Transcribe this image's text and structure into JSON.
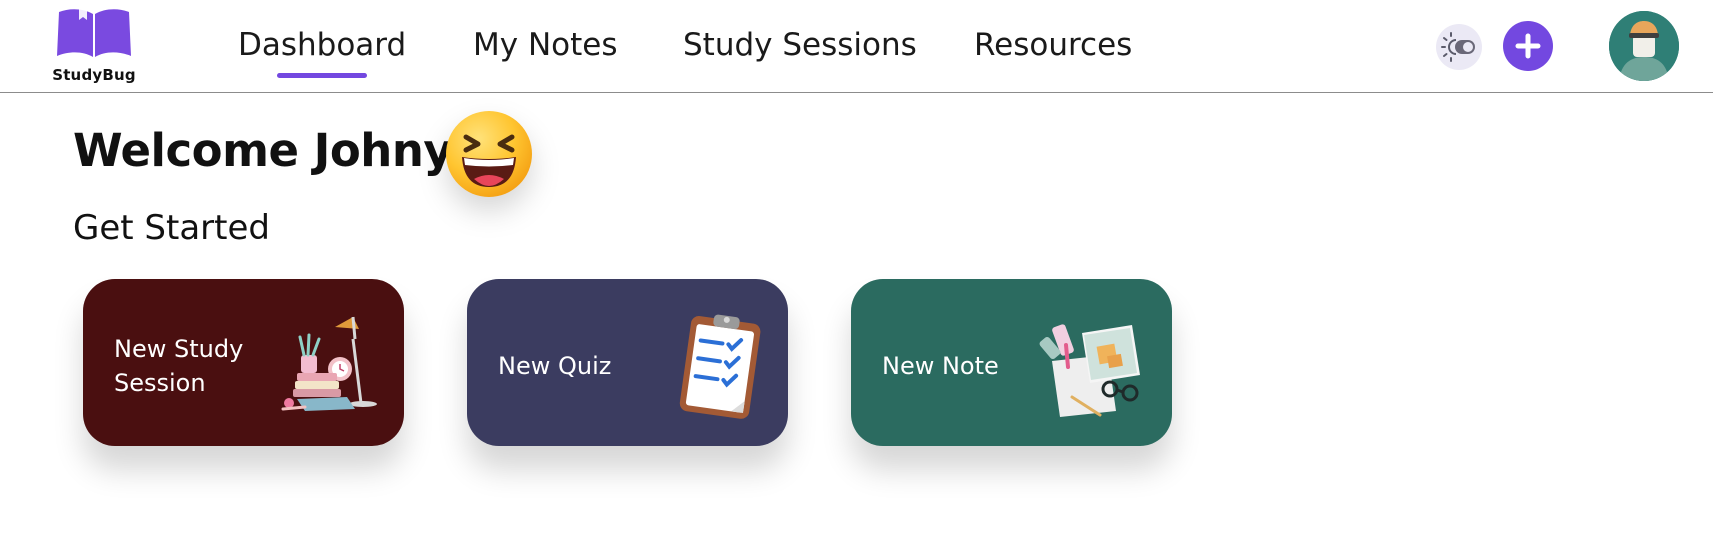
{
  "app": {
    "name": "StudyBug"
  },
  "nav": {
    "items": [
      {
        "label": "Dashboard",
        "active": true
      },
      {
        "label": "My Notes",
        "active": false
      },
      {
        "label": "Study Sessions",
        "active": false
      },
      {
        "label": "Resources",
        "active": false
      }
    ]
  },
  "header_actions": {
    "theme_toggle_icon": "brightness-toggle-icon",
    "add_icon": "plus-icon",
    "avatar_icon": "user-avatar"
  },
  "main": {
    "welcome": "Welcome Johny!",
    "emoji_icon": "laughing-face-emoji",
    "subtitle": "Get Started"
  },
  "cards": [
    {
      "label_line1": "New Study",
      "label_line2": "Session",
      "color": "#4a0f10",
      "icon": "study-desk-illustration"
    },
    {
      "label": "New Quiz",
      "color": "#3b3c60",
      "icon": "clipboard-checklist-illustration"
    },
    {
      "label": "New Note",
      "color": "#2b6b60",
      "icon": "notes-papers-illustration"
    }
  ],
  "colors": {
    "accent": "#7348e0",
    "divider": "#8c8c8c"
  }
}
